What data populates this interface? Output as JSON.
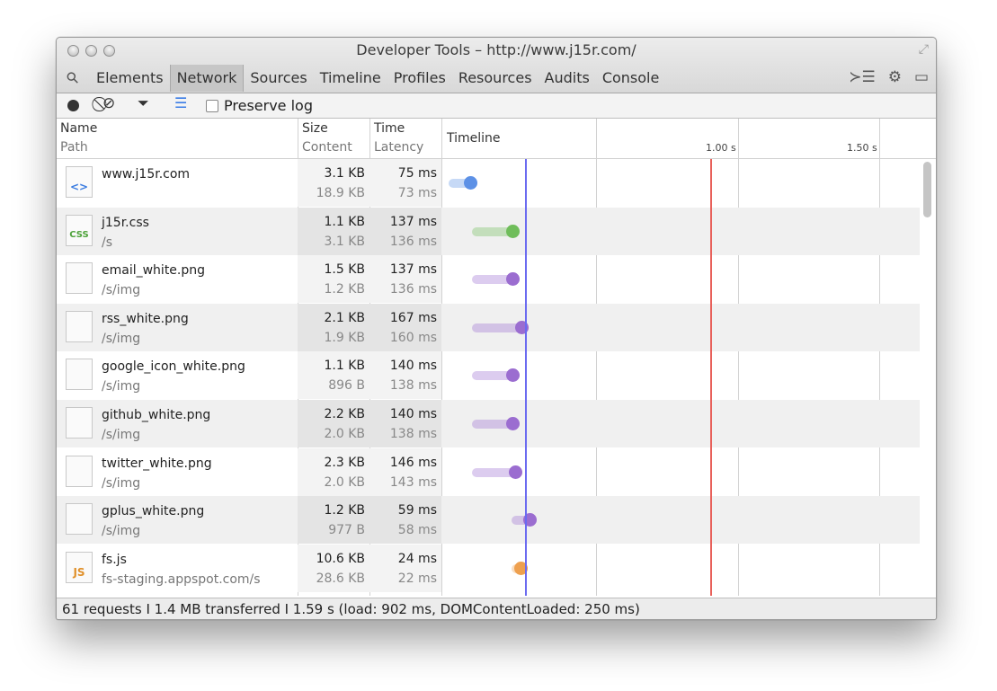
{
  "window": {
    "title": "Developer Tools – http://www.j15r.com/"
  },
  "tabs": [
    "Elements",
    "Network",
    "Sources",
    "Timeline",
    "Profiles",
    "Resources",
    "Audits",
    "Console"
  ],
  "active_tab": "Network",
  "toolbar": {
    "preserve_log_label": "Preserve log",
    "preserve_log_checked": false
  },
  "columns": {
    "name": "Name",
    "path": "Path",
    "size": "Size",
    "content": "Content",
    "time": "Time",
    "latency": "Latency",
    "timeline": "Timeline",
    "tick_1": "1.00 s",
    "tick_2": "1.50 s"
  },
  "requests": [
    {
      "name": "www.j15r.com",
      "path": "",
      "size": "3.1 KB",
      "content": "18.9 KB",
      "time": "75 ms",
      "latency": "73 ms",
      "type": "document",
      "color": "#5d91e6"
    },
    {
      "name": "j15r.css",
      "path": "/s",
      "size": "1.1 KB",
      "content": "3.1 KB",
      "time": "137 ms",
      "latency": "136 ms",
      "type": "css",
      "color": "#6fbd5a"
    },
    {
      "name": "email_white.png",
      "path": "/s/img",
      "size": "1.5 KB",
      "content": "1.2 KB",
      "time": "137 ms",
      "latency": "136 ms",
      "type": "image",
      "color": "#9b6dd0"
    },
    {
      "name": "rss_white.png",
      "path": "/s/img",
      "size": "2.1 KB",
      "content": "1.9 KB",
      "time": "167 ms",
      "latency": "160 ms",
      "type": "image",
      "color": "#9b6dd0"
    },
    {
      "name": "google_icon_white.png",
      "path": "/s/img",
      "size": "1.1 KB",
      "content": "896 B",
      "time": "140 ms",
      "latency": "138 ms",
      "type": "image",
      "color": "#9b6dd0"
    },
    {
      "name": "github_white.png",
      "path": "/s/img",
      "size": "2.2 KB",
      "content": "2.0 KB",
      "time": "140 ms",
      "latency": "138 ms",
      "type": "image",
      "color": "#9b6dd0"
    },
    {
      "name": "twitter_white.png",
      "path": "/s/img",
      "size": "2.3 KB",
      "content": "2.0 KB",
      "time": "146 ms",
      "latency": "143 ms",
      "type": "image",
      "color": "#9b6dd0"
    },
    {
      "name": "gplus_white.png",
      "path": "/s/img",
      "size": "1.2 KB",
      "content": "977 B",
      "time": "59 ms",
      "latency": "58 ms",
      "type": "image",
      "color": "#9b6dd0"
    },
    {
      "name": "fs.js",
      "path": "fs-staging.appspot.com/s",
      "size": "10.6 KB",
      "content": "28.6 KB",
      "time": "24 ms",
      "latency": "22 ms",
      "type": "script",
      "color": "#eea04f"
    }
  ],
  "status": "61 requests I 1.4 MB transferred I 1.59 s (load: 902 ms, DOMContentLoaded: 250 ms)",
  "colors": {
    "dom_content_loaded_line": "#6b6bf0",
    "load_line": "#e8605a"
  }
}
